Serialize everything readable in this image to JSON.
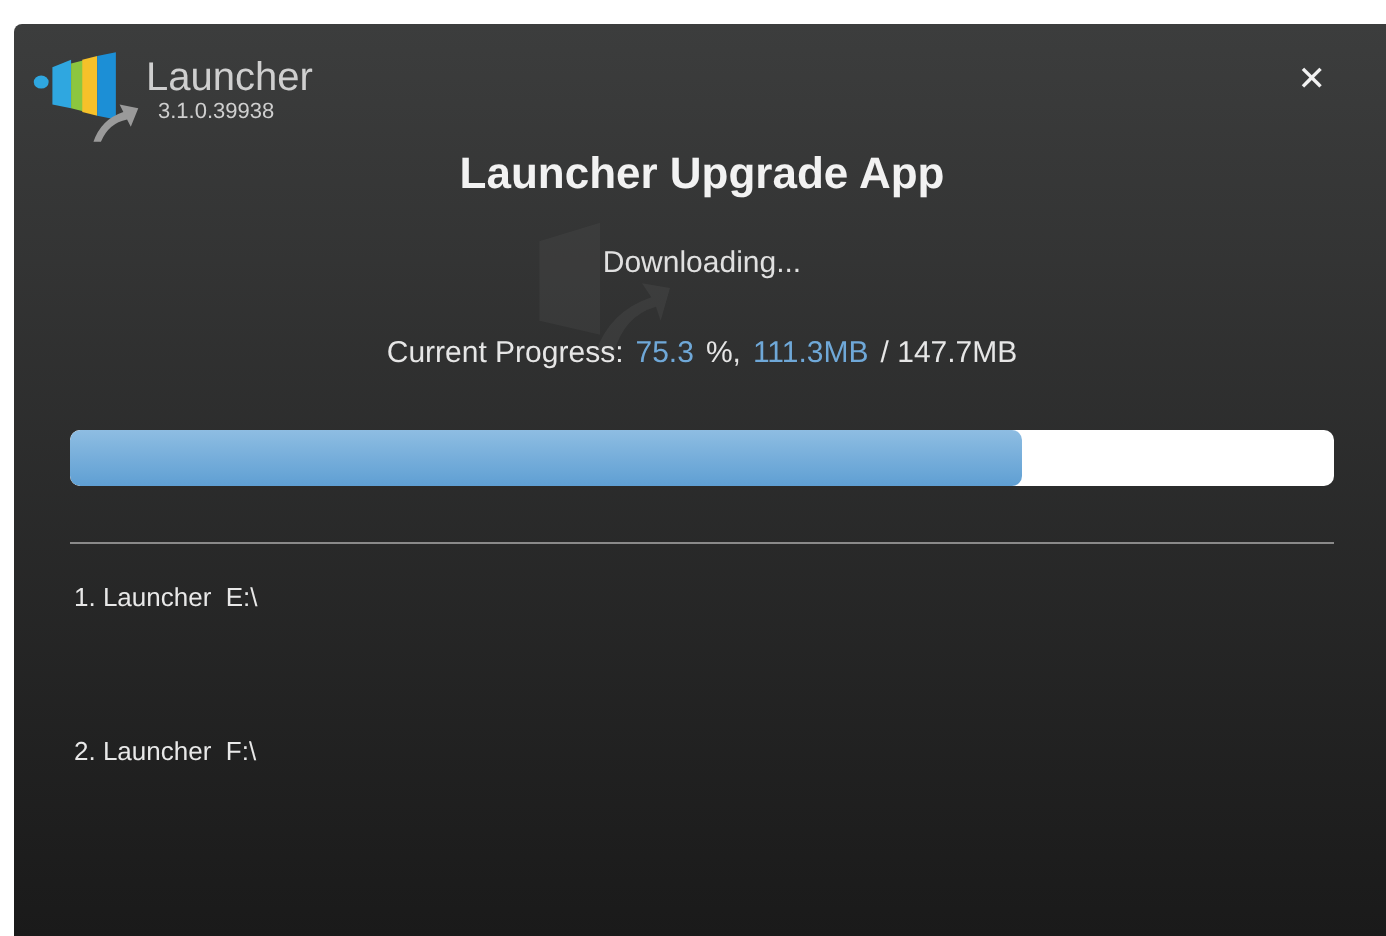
{
  "app": {
    "name": "Launcher",
    "version": "3.1.0.39938"
  },
  "close": "✕",
  "title": "Launcher Upgrade App",
  "status": "Downloading...",
  "progress_text": [
    {
      "kind": "label",
      "text": "Current Progress:"
    },
    {
      "kind": "value",
      "text": "75.3"
    },
    {
      "kind": "label",
      "text": "%,"
    },
    {
      "kind": "value",
      "text": "111.3MB"
    },
    {
      "kind": "label",
      "text": "/ 147.7MB"
    }
  ],
  "progress": {
    "level": 0.753
  },
  "targets": [
    "1. Launcher  E:\\",
    "2. Launcher  F:\\"
  ]
}
